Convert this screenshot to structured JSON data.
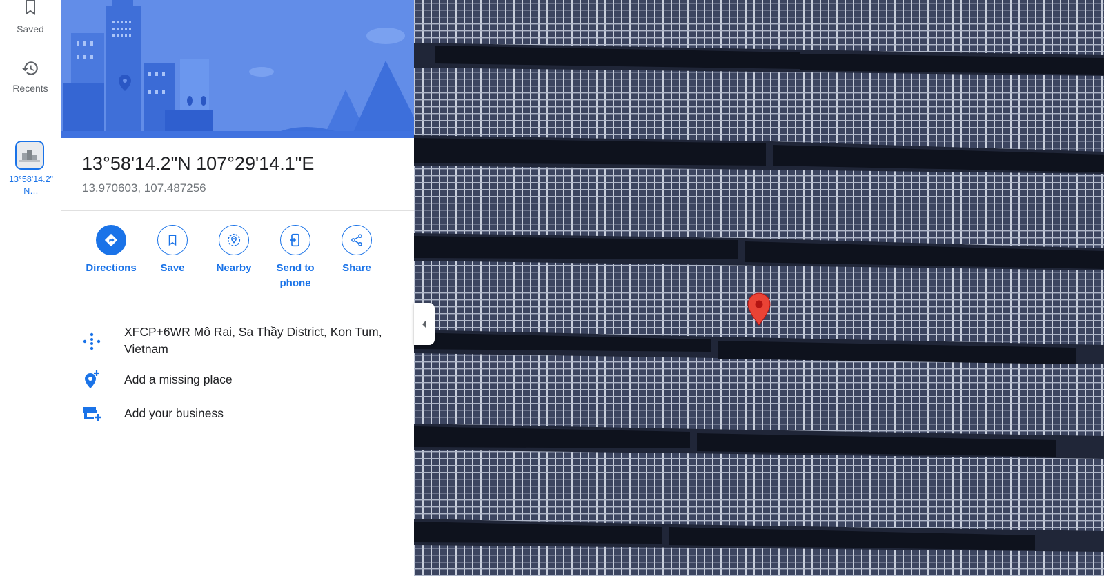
{
  "rail": {
    "saved_label": "Saved",
    "recents_label": "Recents",
    "recent_item_label": "13°58'14.2\" N…"
  },
  "place": {
    "title": "13°58'14.2\"N 107°29'14.1\"E",
    "coords": "13.970603, 107.487256"
  },
  "actions": [
    {
      "label": "Directions",
      "icon": "directions-icon"
    },
    {
      "label": "Save",
      "icon": "bookmark-icon"
    },
    {
      "label": "Nearby",
      "icon": "nearby-icon"
    },
    {
      "label": "Send to phone",
      "icon": "send-to-phone-icon"
    },
    {
      "label": "Share",
      "icon": "share-icon"
    }
  ],
  "details": {
    "plus_code": "XFCP+6WR Mô Rai, Sa Thầy District, Kon Tum, Vietnam",
    "add_missing_place": "Add a missing place",
    "add_business": "Add your business"
  },
  "colors": {
    "accent": "#1a73e8",
    "marker": "#ea4335",
    "hero": "#5b86e5"
  }
}
